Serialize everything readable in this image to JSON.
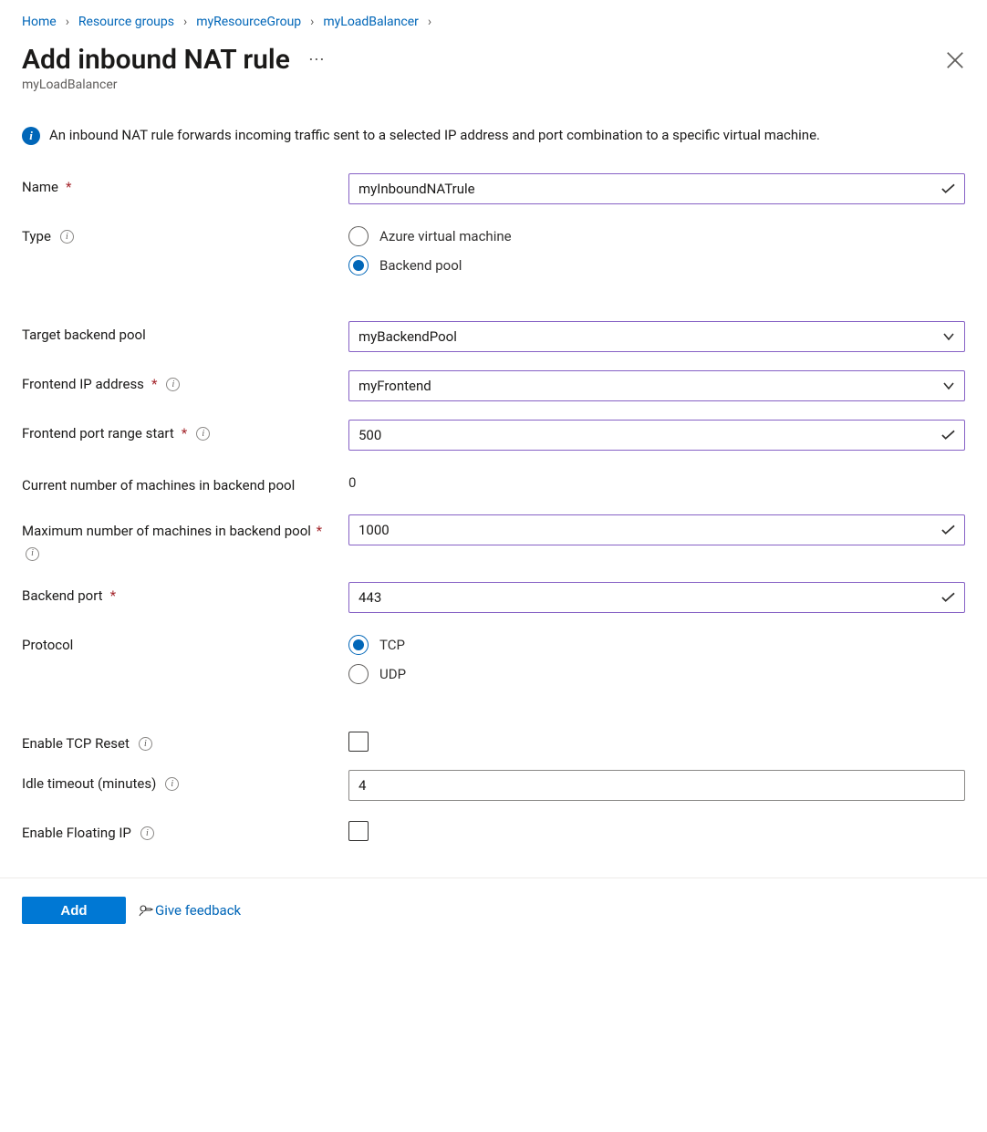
{
  "breadcrumb": [
    {
      "label": "Home"
    },
    {
      "label": "Resource groups"
    },
    {
      "label": "myResourceGroup"
    },
    {
      "label": "myLoadBalancer"
    }
  ],
  "title": "Add inbound NAT rule",
  "subtitle": "myLoadBalancer",
  "info_text": "An inbound NAT rule forwards incoming traffic sent to a selected IP address and port combination to a specific virtual machine.",
  "form": {
    "name": {
      "label": "Name",
      "value": "myInboundNATrule"
    },
    "type": {
      "label": "Type",
      "options": [
        {
          "label": "Azure virtual machine",
          "selected": false
        },
        {
          "label": "Backend pool",
          "selected": true
        }
      ]
    },
    "target_backend_pool": {
      "label": "Target backend pool",
      "value": "myBackendPool"
    },
    "frontend_ip": {
      "label": "Frontend IP address",
      "value": "myFrontend"
    },
    "frontend_port_start": {
      "label": "Frontend port range start",
      "value": "500"
    },
    "current_machines": {
      "label": "Current number of machines in backend pool",
      "value": "0"
    },
    "max_machines": {
      "label": "Maximum number of machines in backend pool",
      "value": "1000"
    },
    "backend_port": {
      "label": "Backend port",
      "value": "443"
    },
    "protocol": {
      "label": "Protocol",
      "options": [
        {
          "label": "TCP",
          "selected": true
        },
        {
          "label": "UDP",
          "selected": false
        }
      ]
    },
    "tcp_reset": {
      "label": "Enable TCP Reset",
      "checked": false
    },
    "idle_timeout": {
      "label": "Idle timeout (minutes)",
      "value": "4"
    },
    "floating_ip": {
      "label": "Enable Floating IP",
      "checked": false
    }
  },
  "footer": {
    "add_label": "Add",
    "feedback_label": "Give feedback"
  }
}
